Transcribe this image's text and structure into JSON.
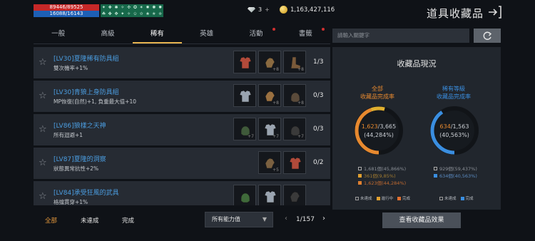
{
  "player": {
    "hp": "89446/89525",
    "mp": "16088/16143"
  },
  "buffs": [
    "✦",
    "✚",
    "✱",
    "✧",
    "✣",
    "✪",
    "✶",
    "✸",
    "✺",
    "✹",
    "☘",
    "✤",
    "✥",
    "✦",
    "✧",
    "✩",
    "✫",
    "✬",
    "✭",
    "✮"
  ],
  "currency": {
    "gems": "3",
    "gems_plus": "+",
    "gold": "1,163,427,116"
  },
  "header": {
    "title": "道具收藏品"
  },
  "tabs": [
    {
      "label": "一般",
      "dot": false
    },
    {
      "label": "高級",
      "dot": false
    },
    {
      "label": "稀有",
      "dot": false,
      "active": true
    },
    {
      "label": "英雄",
      "dot": false
    },
    {
      "label": "活動",
      "dot": true
    },
    {
      "label": "書籤",
      "dot": true
    }
  ],
  "collections": [
    {
      "title": "[LV30]夏隆稀有防具組",
      "desc": "雙次機率+1%",
      "count": "1/3",
      "items": [
        {
          "icon": "armor-icon",
          "cnt": "",
          "color": "#b24a3a"
        },
        {
          "icon": "gauntlet-icon",
          "cnt": "+8",
          "color": "#8a6a40"
        },
        {
          "icon": "boots-icon",
          "cnt": "+8",
          "color": "#7a5a3a"
        }
      ]
    },
    {
      "title": "[LV30]青狼上身防具組",
      "desc": "MP恢復(自然)+1, 負重最大值+10",
      "count": "0/3",
      "items": [
        {
          "icon": "armor-icon",
          "cnt": "",
          "color": "#9aa4b0"
        },
        {
          "icon": "gauntlet-icon",
          "cnt": "+8",
          "color": "#9a7040"
        },
        {
          "icon": "helm-icon",
          "cnt": "+8",
          "color": "#5a4a3a"
        }
      ]
    },
    {
      "title": "[LV86]狼樣之天神",
      "desc": "所有迴避+1",
      "count": "0/3",
      "items": [
        {
          "icon": "helm-icon",
          "cnt": "+7",
          "color": "#3f5a3a"
        },
        {
          "icon": "armor-icon",
          "cnt": "+7",
          "color": "#9aa4b0"
        },
        {
          "icon": "helm-icon",
          "cnt": "+7",
          "color": "#3a3a3a"
        }
      ]
    },
    {
      "title": "[LV87]夏隆的洞察",
      "desc": "狀態異常抗性+2%",
      "count": "0/2",
      "items": [
        {
          "icon": "gauntlet-icon",
          "cnt": "+5",
          "color": "#7a6040"
        },
        {
          "icon": "armor-icon",
          "cnt": "",
          "color": "#b04a3a"
        }
      ]
    },
    {
      "title": "[LV84]承受狂風的武具",
      "desc": "格擋貫穿+1%",
      "count": "",
      "items": [
        {
          "icon": "helm-icon",
          "cnt": "",
          "color": "#3f6a3a"
        },
        {
          "icon": "armor-icon",
          "cnt": "",
          "color": "#9aa4b0"
        },
        {
          "icon": "gauntlet-icon",
          "cnt": "",
          "color": "#3a3a3a"
        }
      ]
    }
  ],
  "bottom": {
    "filters": [
      {
        "label": "全部",
        "active": true
      },
      {
        "label": "未達成",
        "active": false
      },
      {
        "label": "完成",
        "active": false
      }
    ],
    "dropdown": "所有能力值",
    "page": "1/157"
  },
  "search": {
    "placeholder": "請輸入關鍵字"
  },
  "status": {
    "title": "收藏品現況",
    "left": {
      "head1": "全部",
      "head2": "收藏品完成率",
      "value": "1,623",
      "total": "/3,665",
      "pct": "(44,284%)",
      "fraction": 0.44284,
      "stats": [
        {
          "text": "1,681個(45,866%)",
          "color": "#ffffff",
          "label_color": "#8a8f96"
        },
        {
          "text": "361個(9,85%)",
          "color": "#e0a030",
          "label_color": "#a07a30"
        },
        {
          "text": "1,623個(44,284%)",
          "color": "#e08030",
          "label_color": "#c06a30"
        }
      ]
    },
    "right": {
      "head1": "稀有等級",
      "head2": "收藏品完成率",
      "value": "634",
      "total": "/1,563",
      "pct": "(40,563%)",
      "fraction": 0.40563,
      "stats": [
        {
          "text": "929個(59,437%)",
          "color": "#ffffff",
          "label_color": "#8a8f96"
        },
        {
          "text": "634個(40,563%)",
          "color": "#3a8ee0",
          "label_color": "#5a8ac0"
        }
      ]
    },
    "legend_left": [
      {
        "label": "未達成",
        "color": "#2a2f36"
      },
      {
        "label": "進行中",
        "color": "#e0a030"
      },
      {
        "label": "完成",
        "color": "#e07030"
      }
    ],
    "legend_right": [
      {
        "label": "未達成",
        "color": "#2a2f36"
      },
      {
        "label": "完成",
        "color": "#3a8ee0"
      }
    ]
  },
  "effect_button": "查看收藏品效果",
  "colors": {
    "accent_orange": "#e7892f",
    "accent_blue": "#3a8ee0",
    "link_blue": "#4b9de0"
  }
}
